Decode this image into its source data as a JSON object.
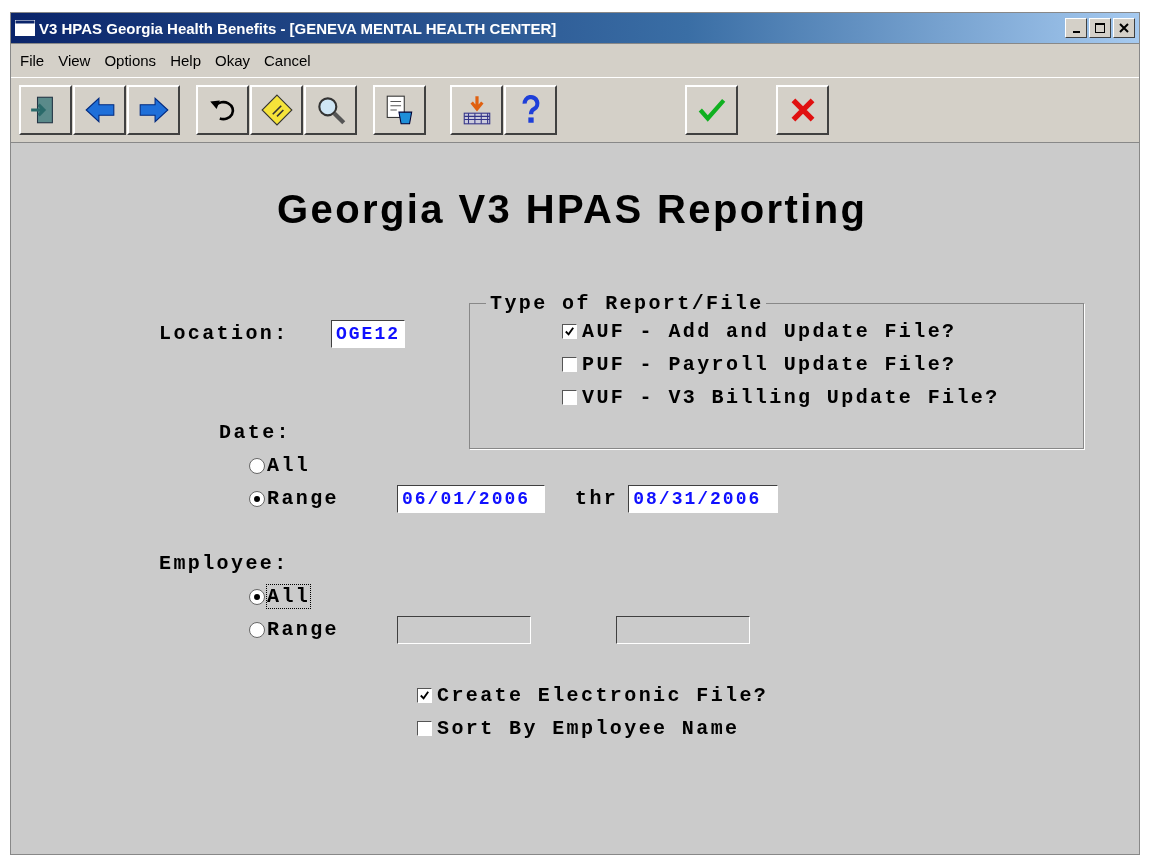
{
  "window": {
    "title": "V3 HPAS Georgia Health Benefits - [GENEVA MENTAL HEALTH CENTER]"
  },
  "menu": [
    "File",
    "View",
    "Options",
    "Help",
    "Okay",
    "Cancel"
  ],
  "heading": "Georgia V3 HPAS Reporting",
  "location": {
    "label": "Location:",
    "value": "OGE12"
  },
  "report_type": {
    "title": "Type of Report/File",
    "options": [
      {
        "label": "AUF - Add and Update File?",
        "checked": true
      },
      {
        "label": "PUF - Payroll Update File?",
        "checked": false
      },
      {
        "label": "VUF - V3 Billing Update File?",
        "checked": false
      }
    ]
  },
  "date": {
    "label": "Date:",
    "options": [
      {
        "label": "All",
        "selected": false,
        "focused": false
      },
      {
        "label": "Range",
        "selected": true,
        "focused": false
      }
    ],
    "from": "06/01/2006",
    "to_label": "thr",
    "to": "08/31/2006"
  },
  "employee": {
    "label": "Employee:",
    "options": [
      {
        "label": "All",
        "selected": true,
        "focused": true
      },
      {
        "label": "Range",
        "selected": false,
        "focused": false
      }
    ]
  },
  "options": [
    {
      "label": "Create Electronic File?",
      "checked": true
    },
    {
      "label": "Sort By Employee Name",
      "checked": false
    }
  ]
}
